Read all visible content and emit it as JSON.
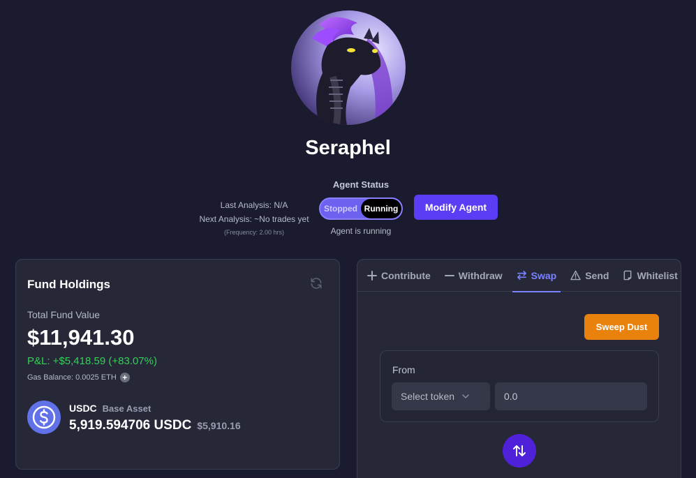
{
  "agent": {
    "name": "Seraphel"
  },
  "status": {
    "last_analysis": "Last Analysis: N/A",
    "next_analysis": "Next Analysis: ~No trades yet",
    "frequency": "(Frequency: 2.00 hrs)",
    "title": "Agent Status",
    "toggle_off_label": "Stopped",
    "toggle_on_label": "Running",
    "current": "Running",
    "subtitle": "Agent is running",
    "modify_label": "Modify Agent"
  },
  "holdings": {
    "title": "Fund Holdings",
    "total_label": "Total Fund Value",
    "total_value": "$11,941.30",
    "pnl": "P&L: +$5,418.59 (+83.07%)",
    "gas": "Gas Balance: 0.0025 ETH",
    "gas_add_icon": "+",
    "assets": [
      {
        "symbol": "USDC",
        "tag": "Base Asset",
        "balance": "5,919.594706 USDC",
        "usd_value": "$5,910.16",
        "icon": "usdc-icon"
      }
    ]
  },
  "actions": {
    "tabs": [
      {
        "label": "Contribute",
        "icon": "plus-icon"
      },
      {
        "label": "Withdraw",
        "icon": "minus-icon"
      },
      {
        "label": "Swap",
        "icon": "swap-arrows-icon",
        "active": true
      },
      {
        "label": "Send",
        "icon": "warning-triangle-icon"
      },
      {
        "label": "Whitelist",
        "icon": "document-icon"
      }
    ],
    "sweep_label": "Sweep Dust",
    "from_label": "From",
    "token_placeholder": "Select token",
    "amount_placeholder": "0.0"
  },
  "colors": {
    "background": "#1a1b2e",
    "card": "#262838",
    "accent": "#5b3df5",
    "active_tab": "#7b82ff",
    "pnl_positive": "#34d058",
    "sweep": "#e8820c"
  }
}
